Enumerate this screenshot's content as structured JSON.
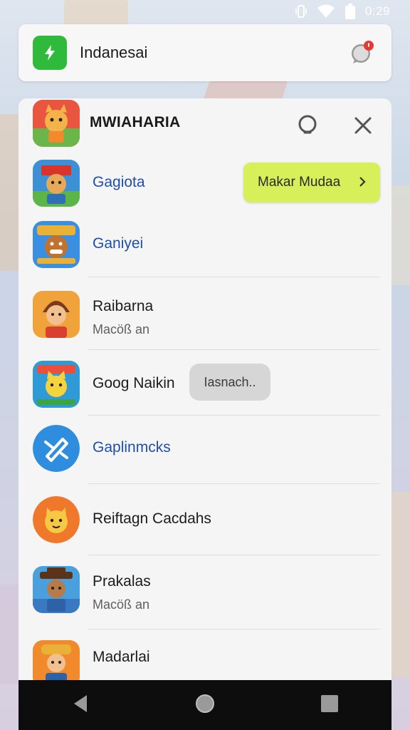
{
  "status_bar": {
    "time": "0:29",
    "icons": [
      "vibrate-icon",
      "wifi-icon",
      "battery-icon"
    ]
  },
  "notification": {
    "title": "Indanesai",
    "app_icon": "bolt-icon",
    "app_icon_color": "#2fba3b",
    "action_icon": "chat-bubble-icon",
    "badge_color": "#e53935"
  },
  "panel": {
    "title": "MWIAHARIA",
    "search_icon": "search-icon",
    "close_icon": "close-icon",
    "items": [
      {
        "title": "Gagiota",
        "subtitle": "",
        "style": "blue"
      },
      {
        "title": "Ganiyei",
        "subtitle": "",
        "style": "blue"
      },
      {
        "title": "Raibarna",
        "subtitle": "Macöß an",
        "style": "dark"
      },
      {
        "title": "Goog Naikin",
        "subtitle": "",
        "style": "dark"
      },
      {
        "title": "Gaplinmcks",
        "subtitle": "",
        "style": "blue"
      },
      {
        "title": "Reiftagn Cacdahs",
        "subtitle": "",
        "style": "dark"
      },
      {
        "title": "Prakalas",
        "subtitle": "Macöß an",
        "style": "dark"
      },
      {
        "title": "Madarlai",
        "subtitle": "",
        "style": "dark"
      }
    ],
    "green_pill": {
      "label": "Makar Mudaa",
      "color": "#d7f05a"
    },
    "grey_pill": {
      "label": "Iasnach.."
    }
  },
  "nav_bar": {
    "buttons": [
      "back-icon",
      "home-icon",
      "recents-icon"
    ]
  }
}
